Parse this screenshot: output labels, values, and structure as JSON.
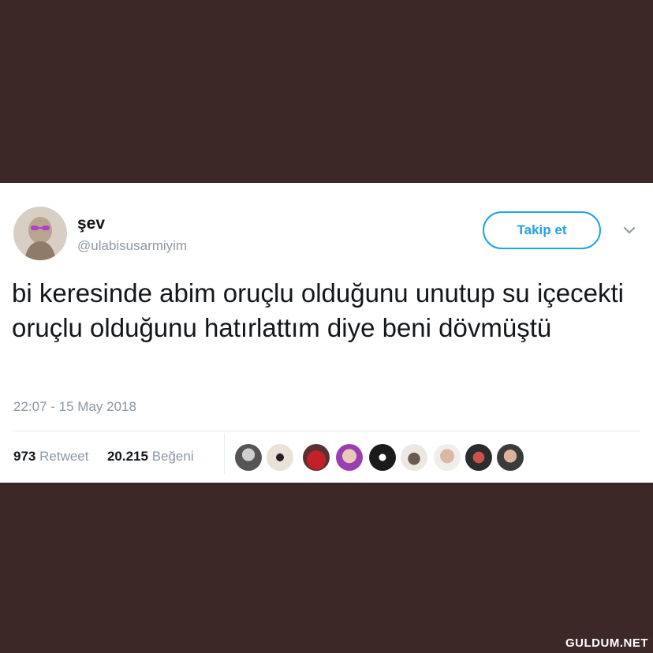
{
  "tweet": {
    "display_name": "şev",
    "handle": "@ulabisusarmiyim",
    "follow_label": "Takip et",
    "text": "bi keresinde abim oruçlu olduğunu unutup su içecekti oruçlu olduğunu hatırlattım diye beni dövmüştü",
    "timestamp": "22:07 - 15 May 2018",
    "retweet_count": "973",
    "retweet_label": "Retweet",
    "like_count": "20.215",
    "like_label": "Beğeni"
  },
  "colors": {
    "background": "#3d2828",
    "accent": "#1da1f2",
    "muted_text": "#8b98a5"
  },
  "icons": {
    "more": "chevron-down-icon",
    "avatar": "user-avatar"
  },
  "watermark": "GULDUM.NET"
}
